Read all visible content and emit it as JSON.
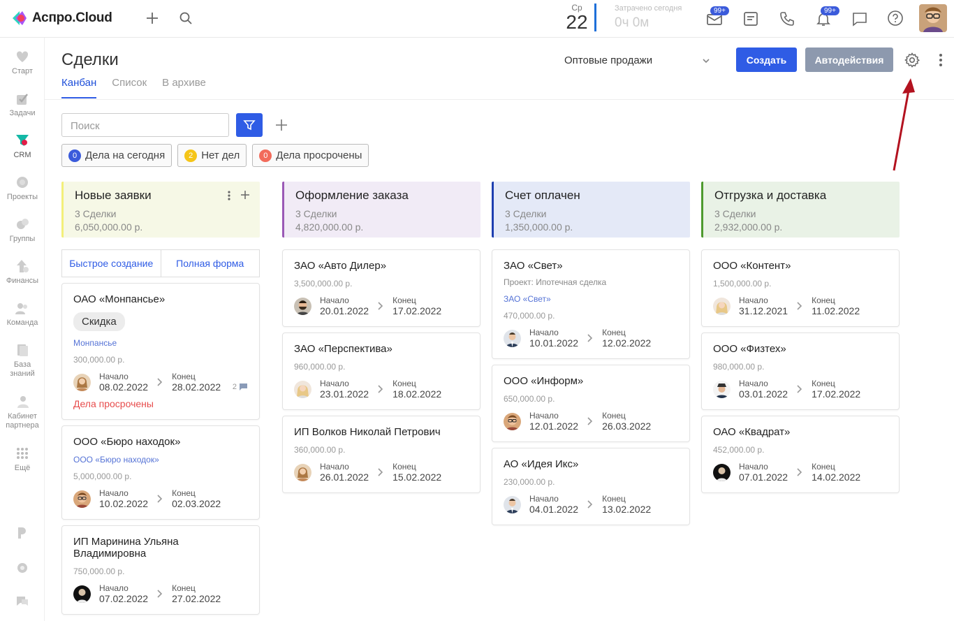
{
  "app": {
    "name": "Аспро.Cloud"
  },
  "header": {
    "date_dow": "Ср",
    "date_day": "22",
    "spent_label": "Затрачено сегодня",
    "spent_value": "0ч 0м",
    "mail_badge": "99+",
    "bell_badge": "99+"
  },
  "sidebar": {
    "items": [
      {
        "label": "Старт"
      },
      {
        "label": "Задачи"
      },
      {
        "label": "CRM"
      },
      {
        "label": "Проекты"
      },
      {
        "label": "Группы"
      },
      {
        "label": "Финансы"
      },
      {
        "label": "Команда"
      },
      {
        "label": "База знаний"
      },
      {
        "label": "Кабинет партнера"
      },
      {
        "label": "Ещё"
      }
    ]
  },
  "page": {
    "title": "Сделки",
    "tabs": [
      {
        "label": "Канбан",
        "active": true
      },
      {
        "label": "Список"
      },
      {
        "label": "В архиве"
      }
    ],
    "pipeline": "Оптовые продажи",
    "create_label": "Создать",
    "auto_label": "Автодействия",
    "search_placeholder": "Поиск"
  },
  "chips": [
    {
      "count": "0",
      "label": "Дела на сегодня",
      "color": "#3b5bdb"
    },
    {
      "count": "2",
      "label": "Нет дел",
      "color": "#f5c518"
    },
    {
      "count": "0",
      "label": "Дела просрочены",
      "color": "#f26b5b"
    }
  ],
  "columns": [
    {
      "title": "Новые заявки",
      "count": "3 Сделки",
      "sum": "6,050,000.00 р.",
      "bg": "#f6f8e6",
      "accent": "#f3ef7a",
      "quick_create": "Быстрое создание",
      "full_form": "Полная форма",
      "cards": [
        {
          "title": "ОАО «Монпансье»",
          "tag": "Скидка",
          "link": "Монпансье",
          "amount": "300,000.00 р.",
          "start_label": "Начало",
          "start": "08.02.2022",
          "end_label": "Конец",
          "end": "28.02.2022",
          "avatar": "woman",
          "overdue": "Дела просрочены",
          "comments": "2"
        },
        {
          "title": "ООО «Бюро находок»",
          "link": "ООО «Бюро находок»",
          "amount": "5,000,000.00 р.",
          "start_label": "Начало",
          "start": "10.02.2022",
          "end_label": "Конец",
          "end": "02.03.2022",
          "avatar": "glasses"
        },
        {
          "title": "ИП Маринина Ульяна Владимировна",
          "amount": "750,000.00 р.",
          "start_label": "Начало",
          "start": "07.02.2022",
          "end_label": "Конец",
          "end": "27.02.2022",
          "avatar": "dark"
        }
      ]
    },
    {
      "title": "Оформление заказа",
      "count": "3 Сделки",
      "sum": "4,820,000.00 р.",
      "bg": "#f1ebf6",
      "accent": "#9b59b6",
      "cards": [
        {
          "title": "ЗАО «Авто Дилер»",
          "amount": "3,500,000.00 р.",
          "start_label": "Начало",
          "start": "20.01.2022",
          "end_label": "Конец",
          "end": "17.02.2022",
          "avatar": "beard"
        },
        {
          "title": "ЗАО «Перспектива»",
          "amount": "960,000.00 р.",
          "start_label": "Начало",
          "start": "23.01.2022",
          "end_label": "Конец",
          "end": "18.02.2022",
          "avatar": "blonde"
        },
        {
          "title": "ИП Волков Николай Петрович",
          "amount": "360,000.00 р.",
          "start_label": "Начало",
          "start": "26.01.2022",
          "end_label": "Конец",
          "end": "15.02.2022",
          "avatar": "woman"
        }
      ]
    },
    {
      "title": "Счет оплачен",
      "count": "3 Сделки",
      "sum": "1,350,000.00 р.",
      "bg": "#e4e9f7",
      "accent": "#1e3fb0",
      "cards": [
        {
          "title": "ЗАО «Свет»",
          "sub": "Проект: Ипотечная сделка",
          "link": "ЗАО «Свет»",
          "amount": "470,000.00 р.",
          "start_label": "Начало",
          "start": "10.01.2022",
          "end_label": "Конец",
          "end": "12.02.2022",
          "avatar": "suit"
        },
        {
          "title": "ООО «Информ»",
          "amount": "650,000.00 р.",
          "start_label": "Начало",
          "start": "12.01.2022",
          "end_label": "Конец",
          "end": "26.03.2022",
          "avatar": "glasses"
        },
        {
          "title": "АО «Идея Икс»",
          "amount": "230,000.00 р.",
          "start_label": "Начало",
          "start": "04.01.2022",
          "end_label": "Конец",
          "end": "13.02.2022",
          "avatar": "suit"
        }
      ]
    },
    {
      "title": "Отгрузка и доставка",
      "count": "3 Сделки",
      "sum": "2,932,000.00 р.",
      "bg": "#e9f2e6",
      "accent": "#4e9a2f",
      "cards": [
        {
          "title": "ООО «Контент»",
          "amount": "1,500,000.00 р.",
          "start_label": "Начало",
          "start": "31.12.2021",
          "end_label": "Конец",
          "end": "11.02.2022",
          "avatar": "blonde"
        },
        {
          "title": "ООО «Физтех»",
          "amount": "980,000.00 р.",
          "start_label": "Начало",
          "start": "03.01.2022",
          "end_label": "Конец",
          "end": "17.02.2022",
          "avatar": "hat"
        },
        {
          "title": "ОАО «Квадрат»",
          "amount": "452,000.00 р.",
          "start_label": "Начало",
          "start": "07.01.2022",
          "end_label": "Конец",
          "end": "14.02.2022",
          "avatar": "dark"
        }
      ]
    }
  ]
}
